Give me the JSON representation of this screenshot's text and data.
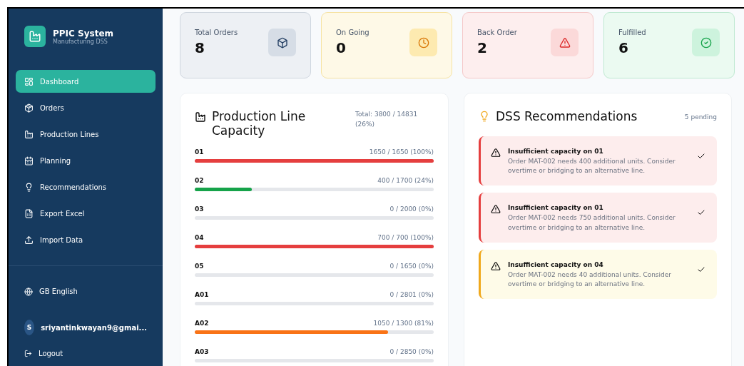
{
  "sidebar": {
    "app_title": "PPIC System",
    "app_subtitle": "Manufacturing DSS",
    "items": [
      {
        "label": "Dashboard",
        "selected": true
      },
      {
        "label": "Orders",
        "selected": false
      },
      {
        "label": "Production Lines",
        "selected": false
      },
      {
        "label": "Planning",
        "selected": false
      },
      {
        "label": "Recommendations",
        "selected": false
      },
      {
        "label": "Export Excel",
        "selected": false
      },
      {
        "label": "Import Data",
        "selected": false
      }
    ],
    "language": "GB English",
    "user": {
      "avatar": "S",
      "email": "sriyantinkwayan9@gmai..."
    },
    "logout": "Logout"
  },
  "stats": [
    {
      "label": "Total Orders",
      "value": "8",
      "kind": "total"
    },
    {
      "label": "On Going",
      "value": "0",
      "kind": "ongoing"
    },
    {
      "label": "Back Order",
      "value": "2",
      "kind": "back"
    },
    {
      "label": "Fulfilled",
      "value": "6",
      "kind": "done"
    }
  ],
  "capacity": {
    "title": "Production Line Capacity",
    "total": "Total: 3800 / 14831 (26%)",
    "lines": [
      {
        "name": "01",
        "reading": "1650 / 1650 (100%)",
        "level": 1,
        "color": "#e53e3e"
      },
      {
        "name": "02",
        "reading": "400 / 1700 (24%)",
        "level": 0.24,
        "color": "#16a34a"
      },
      {
        "name": "03",
        "reading": "0 / 2000 (0%)",
        "level": 0
      },
      {
        "name": "04",
        "reading": "700 / 700 (100%)",
        "level": 1,
        "color": "#e53e3e"
      },
      {
        "name": "05",
        "reading": "0 / 1650 (0%)",
        "level": 0
      },
      {
        "name": "A01",
        "reading": "0 / 2801 (0%)",
        "level": 0
      },
      {
        "name": "A02",
        "reading": "1050 / 1300 (81%)",
        "level": 0.81,
        "color": "#f97316"
      },
      {
        "name": "A03",
        "reading": "0 / 2850 (0%)",
        "level": 0
      }
    ]
  },
  "recommendations": {
    "title": "DSS Recommendations",
    "pending": "5 pending",
    "items": [
      {
        "kind": "high",
        "title": "Insufficient capacity on 01",
        "text": "Order MAT-002 needs 400 additional units. Consider overtime or bridging to an alternative line."
      },
      {
        "kind": "high",
        "title": "Insufficient capacity on 01",
        "text": "Order MAT-002 needs 750 additional units. Consider overtime or bridging to an alternative line."
      },
      {
        "kind": "medium",
        "title": "Insufficient capacity on 04",
        "text": "Order MAT-002 needs 40 additional units. Consider overtime or bridging to an alternative line."
      }
    ]
  }
}
